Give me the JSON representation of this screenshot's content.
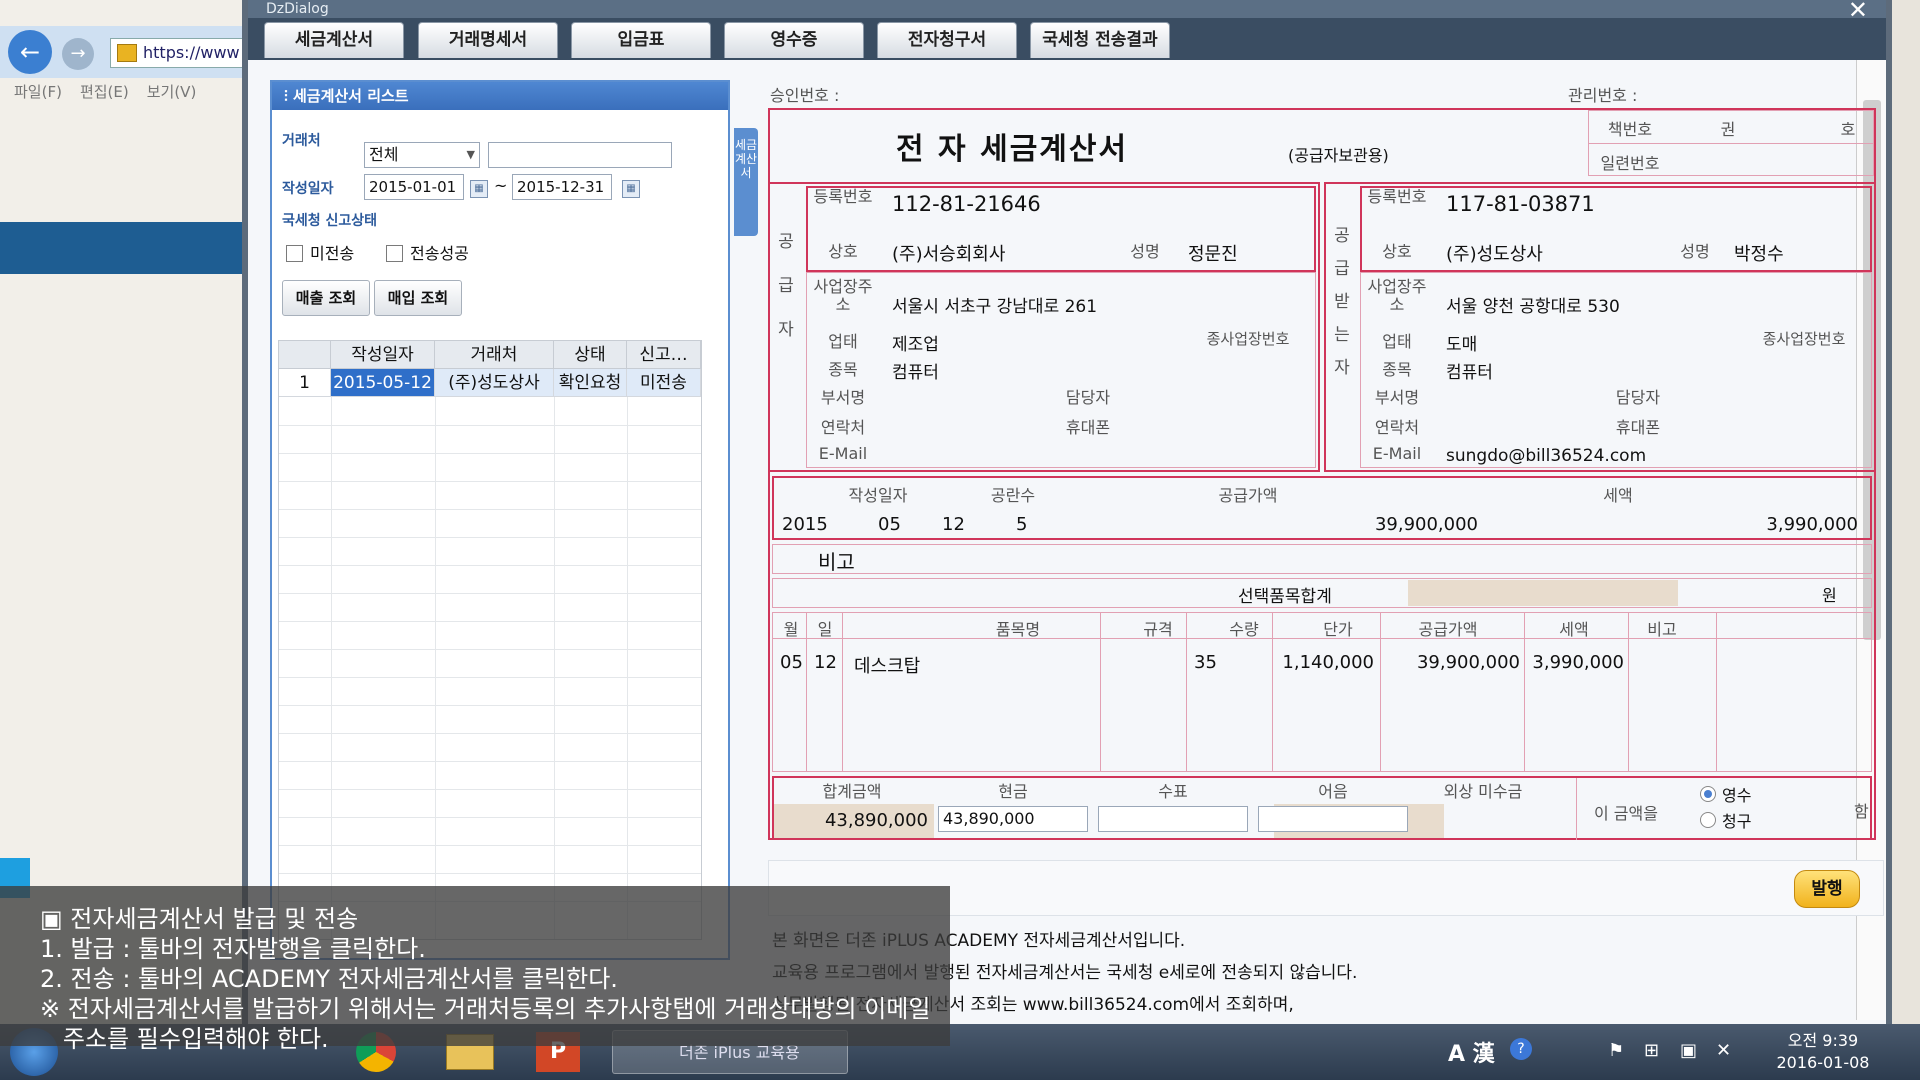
{
  "browser": {
    "url": "https://www",
    "menu": [
      "파일(F)",
      "편집(E)",
      "보기(V)"
    ]
  },
  "dialog": {
    "title": "DzDialog",
    "tabs": [
      "세금계산서",
      "거래명세서",
      "입금표",
      "영수증",
      "전자청구서",
      "국세청 전송결과"
    ]
  },
  "list_panel": {
    "title": "세금계산서 리스트",
    "vertical_tab": "세금계산서",
    "partner_label": "거래처",
    "partner_value": "전체",
    "date_label": "작성일자",
    "date_from": "2015-01-01",
    "date_to": "2015-12-31",
    "date_sep": "~",
    "status_label": "국세청 신고상태",
    "check_unsent": "미전송",
    "check_sent": "전송성공",
    "btn_sales": "매출 조회",
    "btn_purchase": "매입 조회",
    "columns": [
      "작성일자",
      "거래처",
      "상태",
      "신고…"
    ],
    "rows": [
      {
        "no": "1",
        "date": "2015-05-12",
        "partner": "(주)성도상사",
        "status": "확인요청",
        "report": "미전송"
      }
    ]
  },
  "invoice": {
    "approval_label": "승인번호 :",
    "manage_label": "관리번호 :",
    "title": "전 자 세금계산서",
    "subtitle": "(공급자보관용)",
    "book_no_label": "책번호",
    "book_kwon": "권",
    "book_ho": "호",
    "serial_label": "일련번호",
    "supplier_side": "공급자",
    "receiver_side": "공급받는자",
    "labels": {
      "reg": "등록번호",
      "name": "상호",
      "ceo": "성명",
      "addr": "사업장주소",
      "type": "업태",
      "sub_no": "종사업장번호",
      "item": "종목",
      "dept": "부서명",
      "manager": "담당자",
      "contact": "연락처",
      "mobile": "휴대폰",
      "email": "E-Mail"
    },
    "supplier": {
      "reg_no": "112-81-21646",
      "name": "(주)서승회회사",
      "ceo": "정문진",
      "addr": "서울시 서초구 강남대로 261",
      "type": "제조업",
      "item": "컴퓨터",
      "email": ""
    },
    "receiver": {
      "reg_no": "117-81-03871",
      "name": "(주)성도상사",
      "ceo": "박정수",
      "addr": "서울 양천 공항대로 530",
      "type": "도매",
      "item": "컴퓨터",
      "email": "sungdo@bill36524.com"
    },
    "summary_headers": [
      "작성일자",
      "공란수",
      "공급가액",
      "세액"
    ],
    "year": "2015",
    "month": "05",
    "day": "12",
    "blanks": "5",
    "supply_amount": "39,900,000",
    "tax_amount": "3,990,000",
    "remark_label": "비고",
    "selected_total_label": "선택품목합계",
    "won": "원",
    "item_headers": [
      "월",
      "일",
      "품목명",
      "규격",
      "수량",
      "단가",
      "공급가액",
      "세액",
      "비고"
    ],
    "items": [
      {
        "month": "05",
        "day": "12",
        "name": "데스크탑",
        "spec": "",
        "qty": "35",
        "unit_price": "1,140,000",
        "supply": "39,900,000",
        "tax": "3,990,000",
        "note": ""
      }
    ],
    "total_headers": [
      "합계금액",
      "현금",
      "수표",
      "어음",
      "외상 미수금"
    ],
    "total_amount": "43,890,000",
    "cash": "43,890,000",
    "this_amount": "이 금액을",
    "receipt": "영수",
    "claim": "청구",
    "ham": "함",
    "issue_button": "발행",
    "notes": [
      "본 화면은 더존 iPLUS ACADEMY 전자세금계산서입니다.",
      "교육용 프로그램에서 발행된 전자세금계산서는 국세청 e세로에 전송되지 않습니다.",
      "실무발행된 전자세금계산서 조회는 www.bill36524.com에서 조회하며,"
    ]
  },
  "overlay": {
    "lines": [
      "▣ 전자세금계산서 발급 및 전송",
      "1. 발급 : 툴바의 전자발행을 클릭한다.",
      "2. 전송 : 툴바의 ACADEMY 전자세금계산서를 클릭한다.",
      "※ 전자세금계산서를 발급하기 위해서는 거래처등록의 추가사항탭에 거래상대방의 이메일",
      "   주소를 필수입력해야 한다."
    ]
  },
  "taskbar": {
    "active_app": "더존 iPlus 교육용",
    "ime": "A 漢",
    "time": "오전 9:39",
    "date": "2016-01-08"
  }
}
